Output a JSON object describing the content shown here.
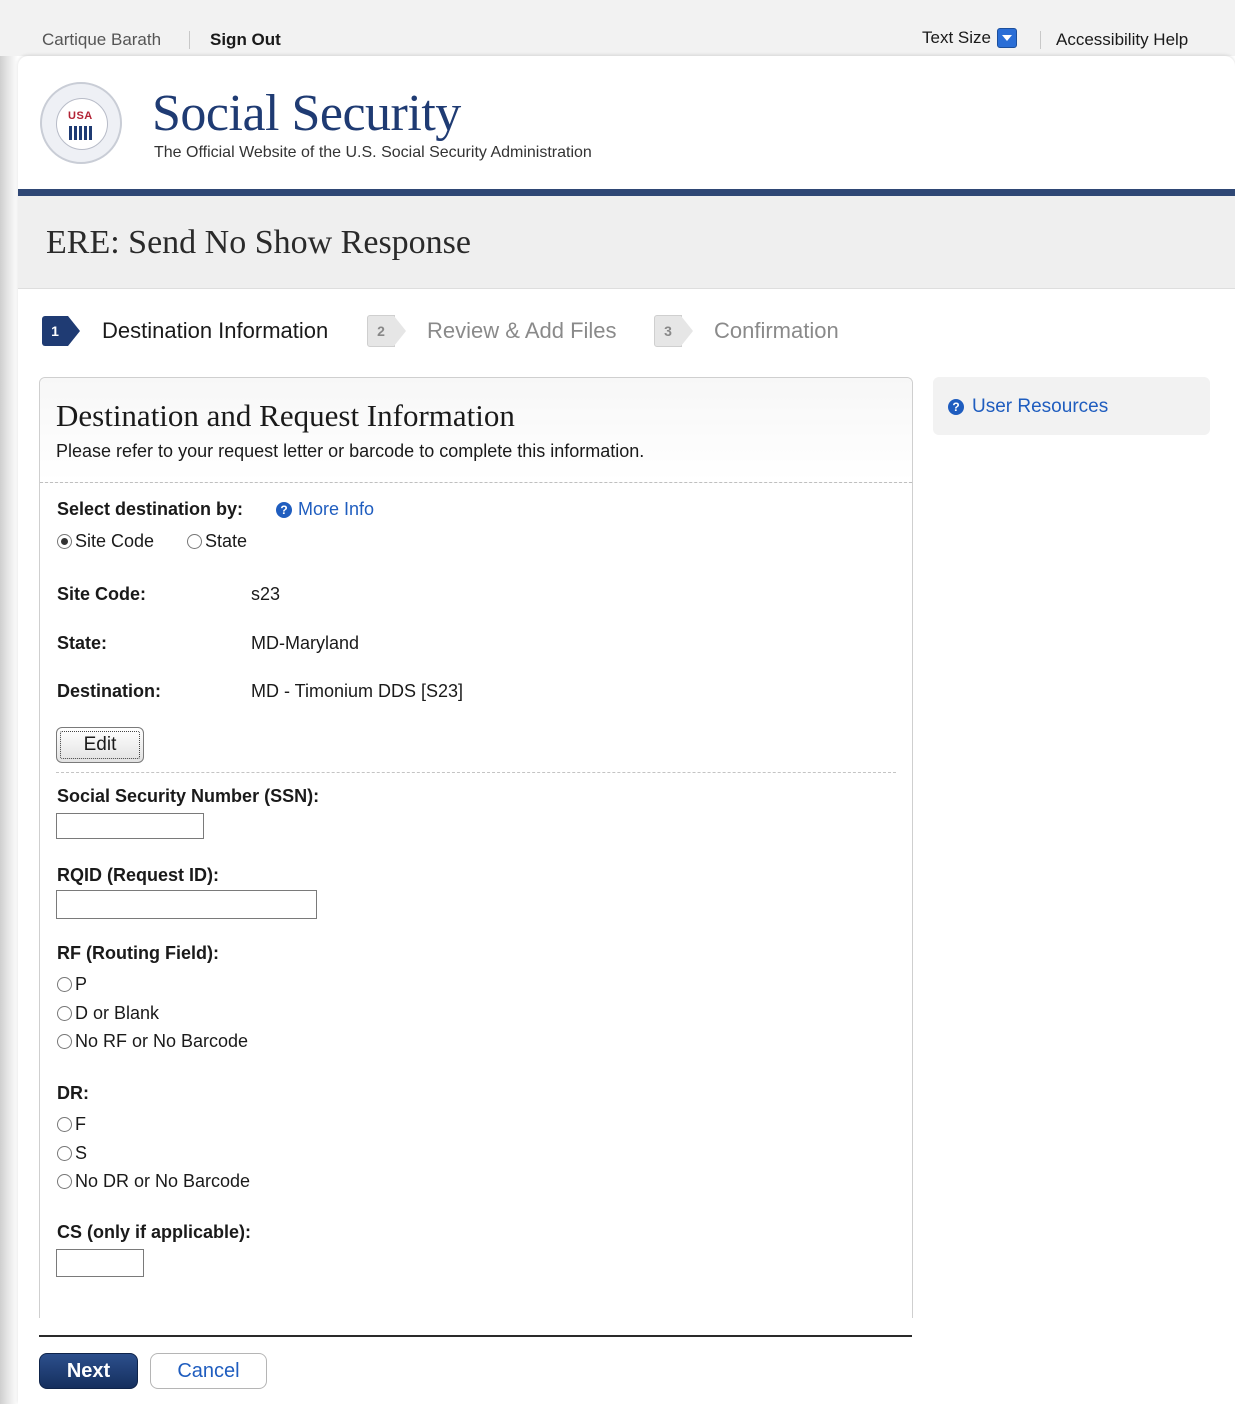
{
  "utility": {
    "user_name": "Cartique Barath",
    "sign_out": "Sign Out",
    "text_size": "Text Size",
    "accessibility_help": "Accessibility Help"
  },
  "brand": {
    "title": "Social Security",
    "subtitle": "The Official Website of the U.S. Social Security Administration",
    "seal_text": "USA"
  },
  "page_title": "ERE: Send No Show Response",
  "steps": [
    {
      "num": "1",
      "label": "Destination Information",
      "active": true
    },
    {
      "num": "2",
      "label": "Review & Add Files",
      "active": false
    },
    {
      "num": "3",
      "label": "Confirmation",
      "active": false
    }
  ],
  "panel": {
    "title": "Destination and Request Information",
    "description": "Please refer to your request letter or barcode to complete this information.",
    "select_destination_label": "Select destination by:",
    "more_info": "More Info",
    "destination_options": [
      {
        "label": "Site Code",
        "selected": true
      },
      {
        "label": "State",
        "selected": false
      }
    ],
    "site_code_label": "Site Code:",
    "site_code_value": "s23",
    "state_label": "State:",
    "state_value": "MD-Maryland",
    "destination_label": "Destination:",
    "destination_value": "MD - Timonium DDS [S23]",
    "edit_button": "Edit",
    "ssn_label": "Social Security Number (SSN):",
    "ssn_value": "",
    "rqid_label": "RQID (Request ID):",
    "rqid_value": "",
    "rf_label": "RF (Routing Field):",
    "rf_options": [
      "P",
      "D or Blank",
      "No RF or No Barcode"
    ],
    "dr_label": "DR:",
    "dr_options": [
      "F",
      "S",
      "No DR or No Barcode"
    ],
    "cs_label": "CS (only if applicable):",
    "cs_value": ""
  },
  "sidebar": {
    "user_resources": "User Resources"
  },
  "actions": {
    "next": "Next",
    "cancel": "Cancel"
  },
  "colors": {
    "navy": "#1f3b73",
    "link_blue": "#1f5dbf"
  }
}
